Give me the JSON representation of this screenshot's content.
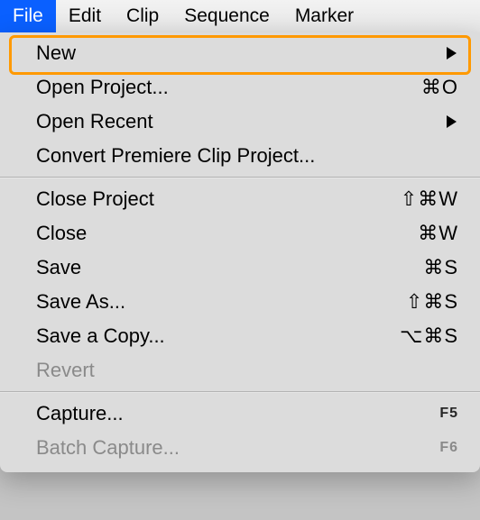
{
  "menubar": {
    "items": [
      {
        "label": "File",
        "selected": true
      },
      {
        "label": "Edit",
        "selected": false
      },
      {
        "label": "Clip",
        "selected": false
      },
      {
        "label": "Sequence",
        "selected": false
      },
      {
        "label": "Marker",
        "selected": false
      }
    ]
  },
  "menu": {
    "groups": [
      [
        {
          "label": "New",
          "shortcut": "",
          "submenu": true,
          "disabled": false,
          "highlighted": true
        },
        {
          "label": "Open Project...",
          "shortcut": "⌘O",
          "submenu": false,
          "disabled": false
        },
        {
          "label": "Open Recent",
          "shortcut": "",
          "submenu": true,
          "disabled": false
        },
        {
          "label": "Convert Premiere Clip Project...",
          "shortcut": "",
          "submenu": false,
          "disabled": false
        }
      ],
      [
        {
          "label": "Close Project",
          "shortcut": "⇧⌘W",
          "submenu": false,
          "disabled": false
        },
        {
          "label": "Close",
          "shortcut": "⌘W",
          "submenu": false,
          "disabled": false
        },
        {
          "label": "Save",
          "shortcut": "⌘S",
          "submenu": false,
          "disabled": false
        },
        {
          "label": "Save As...",
          "shortcut": "⇧⌘S",
          "submenu": false,
          "disabled": false
        },
        {
          "label": "Save a Copy...",
          "shortcut": "⌥⌘S",
          "submenu": false,
          "disabled": false
        },
        {
          "label": "Revert",
          "shortcut": "",
          "submenu": false,
          "disabled": true
        }
      ],
      [
        {
          "label": "Capture...",
          "shortcut": "F5",
          "submenu": false,
          "disabled": false,
          "fkey": true
        },
        {
          "label": "Batch Capture...",
          "shortcut": "F6",
          "submenu": false,
          "disabled": true,
          "fkey": true
        }
      ]
    ]
  }
}
